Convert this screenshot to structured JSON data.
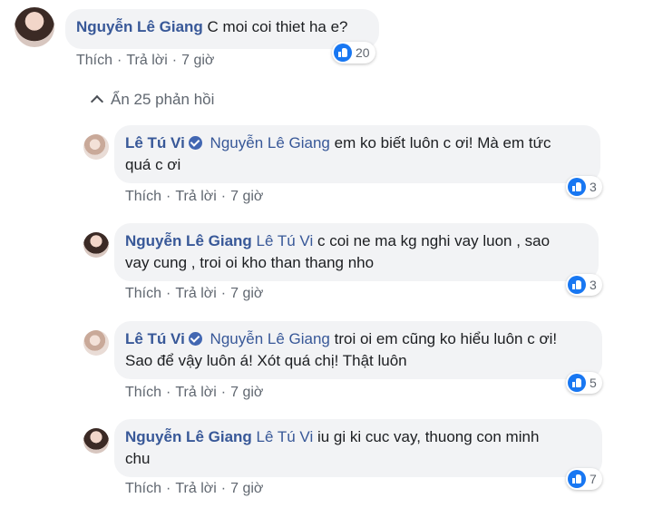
{
  "top_comment": {
    "author": "Nguyễn Lê Giang",
    "text": "C moi coi thiet ha e?",
    "reactions": "20",
    "actions": {
      "like": "Thích",
      "reply": "Trả lời",
      "time": "7 giờ"
    }
  },
  "replies_toggle": "Ẩn 25 phản hồi",
  "replies": [
    {
      "author": "Lê Tú Vi",
      "verified": true,
      "tag": "Nguyễn Lê Giang",
      "text_line1": "em ko biết luôn c ơi! Mà em tức",
      "text_line2": "quá c ơi",
      "reactions": "3",
      "actions": {
        "like": "Thích",
        "reply": "Trả lời",
        "time": "7 giờ"
      }
    },
    {
      "author": "Nguyễn Lê Giang",
      "verified": false,
      "tag": "Lê Tú Vi",
      "text_line1": "c coi ne ma kg nghi vay luon , sao",
      "text_line2": "vay cung , troi oi kho than thang nho",
      "reactions": "3",
      "actions": {
        "like": "Thích",
        "reply": "Trả lời",
        "time": "7 giờ"
      }
    },
    {
      "author": "Lê Tú Vi",
      "verified": true,
      "tag": "Nguyễn Lê Giang",
      "text_line1": "troi oi em cũng ko hiểu luôn c ơi!",
      "text_line2": "Sao để vậy luôn á! Xót quá chị! Thật luôn",
      "reactions": "5",
      "actions": {
        "like": "Thích",
        "reply": "Trả lời",
        "time": "7 giờ"
      }
    },
    {
      "author": "Nguyễn Lê Giang",
      "verified": false,
      "tag": "Lê Tú Vi",
      "text_line1": "iu gi ki cuc vay, thuong con minh",
      "text_line2": "chu",
      "reactions": "7",
      "actions": {
        "like": "Thích",
        "reply": "Trả lời",
        "time": "7 giờ"
      }
    }
  ],
  "colors": {
    "name": "#385898",
    "bubble": "#f2f3f5",
    "meta": "#606770",
    "like": "#1877f2"
  }
}
